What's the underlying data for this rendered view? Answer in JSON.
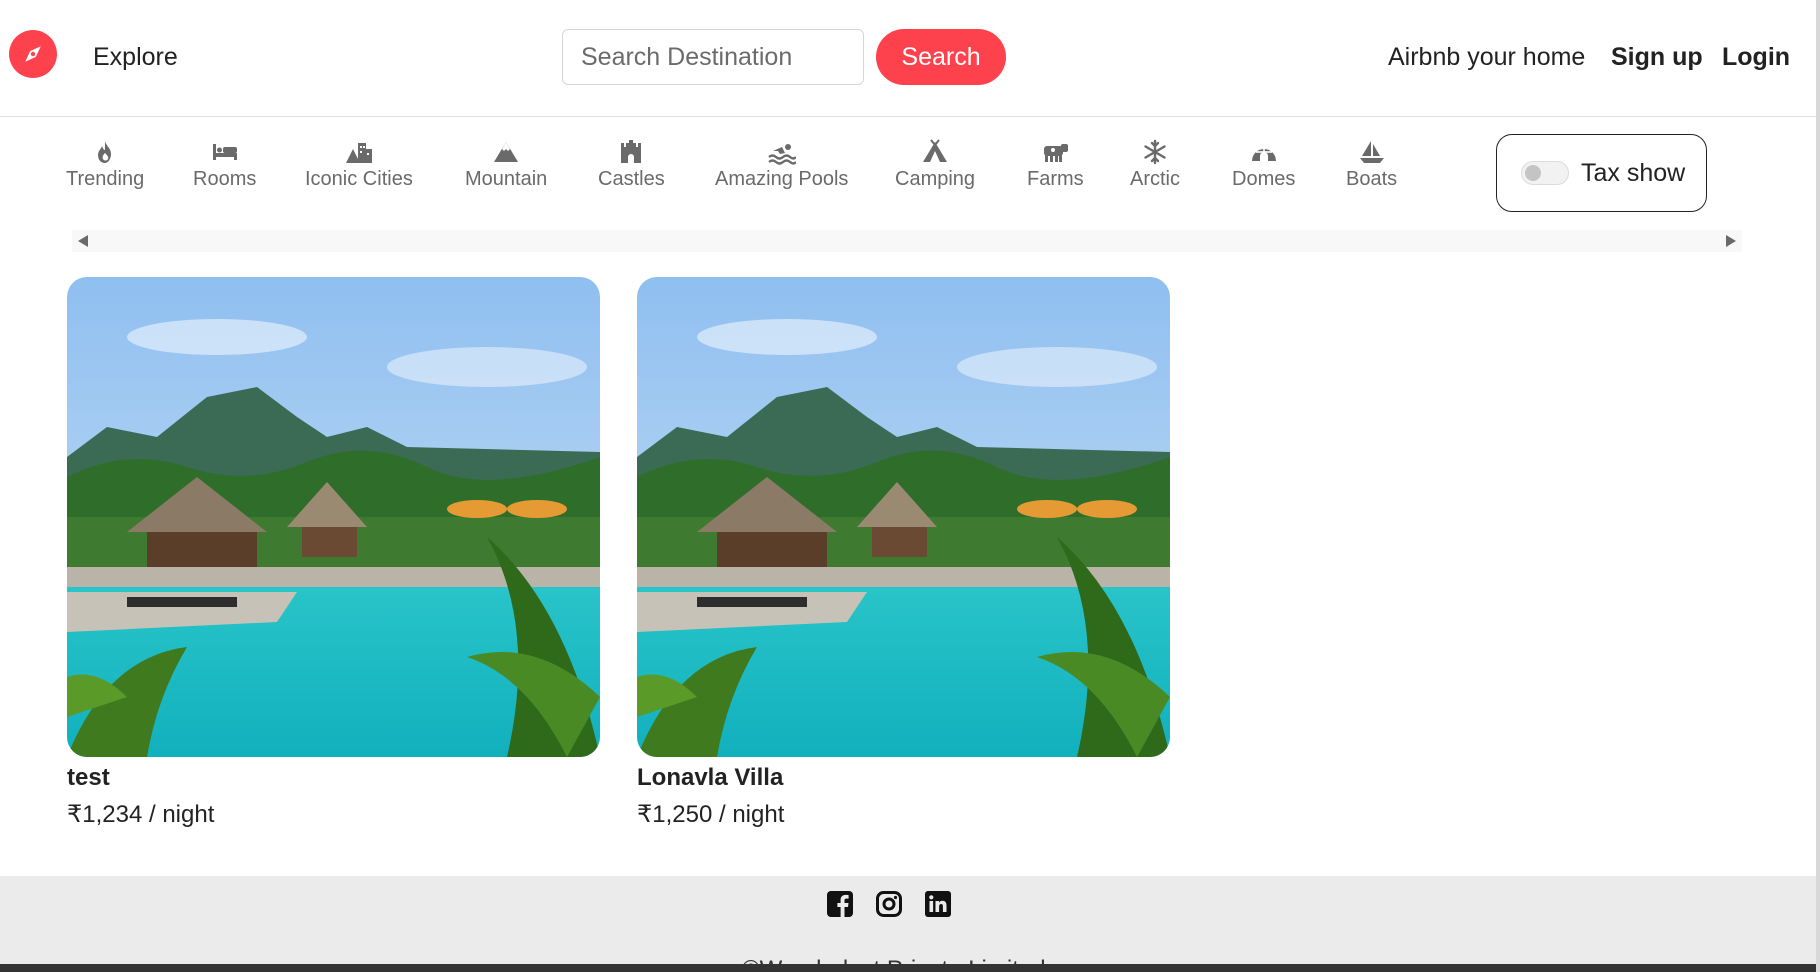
{
  "navbar": {
    "brand_icon": "compass-icon",
    "brand_color": "#fe424d",
    "explore_label": "Explore",
    "search_placeholder": "Search Destination",
    "search_value": "",
    "search_button_label": "Search",
    "host_label": "Airbnb your home",
    "signup_label": "Sign up",
    "login_label": "Login"
  },
  "filters": [
    {
      "label": "Trending",
      "icon": "fire-icon"
    },
    {
      "label": "Rooms",
      "icon": "bed-icon"
    },
    {
      "label": "Iconic Cities",
      "icon": "city-icon"
    },
    {
      "label": "Mountain",
      "icon": "mountain-icon"
    },
    {
      "label": "Castles",
      "icon": "castle-icon"
    },
    {
      "label": "Amazing Pools",
      "icon": "swimmer-icon"
    },
    {
      "label": "Camping",
      "icon": "tent-icon"
    },
    {
      "label": "Farms",
      "icon": "cow-icon"
    },
    {
      "label": "Arctic",
      "icon": "snowflake-icon"
    },
    {
      "label": "Domes",
      "icon": "igloo-icon"
    },
    {
      "label": "Boats",
      "icon": "sailboat-icon"
    }
  ],
  "tax_toggle": {
    "label": "Tax show",
    "checked": false
  },
  "listings": [
    {
      "title": "test",
      "price": "₹1,234 / night"
    },
    {
      "title": "Lonavla Villa",
      "price": "₹1,250 / night"
    }
  ],
  "footer": {
    "socials": [
      "facebook-icon",
      "instagram-icon",
      "linkedin-icon"
    ],
    "copyright": "©Wanderlust Private Limited"
  }
}
